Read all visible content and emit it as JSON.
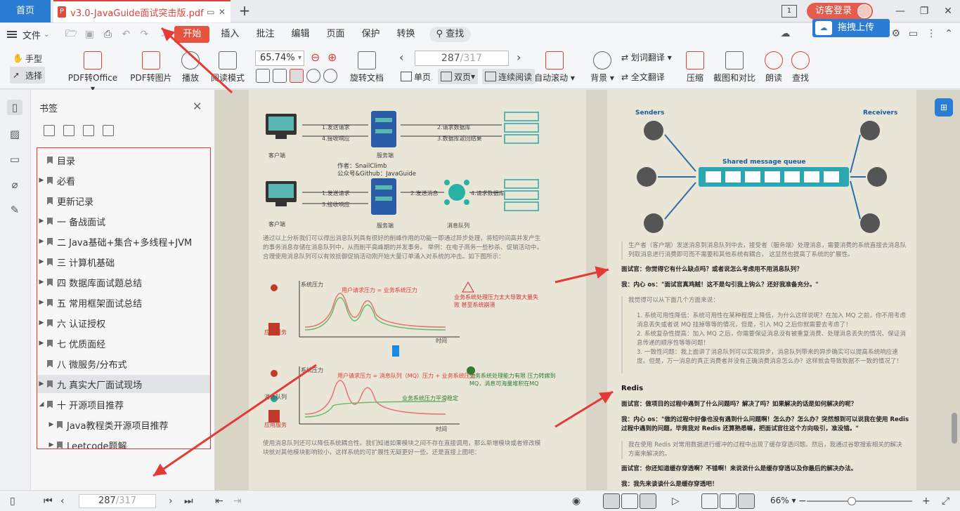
{
  "tabs": {
    "home": "首页",
    "doc_title": "v3.0-JavaGuide面试突击版.pdf",
    "pdf_icon": "P"
  },
  "window": {
    "guest_login": "访客登录",
    "panel_num": "1"
  },
  "menu": {
    "file": "文件",
    "items": [
      "开始",
      "插入",
      "批注",
      "编辑",
      "页面",
      "保护",
      "转换"
    ],
    "search": "查找",
    "upload": "拖拽上传"
  },
  "toolbar": {
    "hand": "手型",
    "select": "选择",
    "pdf_to_office": "PDF转Office",
    "pdf_to_image": "PDF转图片",
    "play": "播放",
    "read_mode": "阅读模式",
    "zoom": "65.74%",
    "rotate": "旋转文档",
    "page_current": "287",
    "page_total": "/317",
    "single": "单页",
    "double": "双页",
    "continuous": "连续阅读",
    "auto_scroll": "自动滚动",
    "background": "背景",
    "word_translate": "划词翻译",
    "full_translate": "全文翻译",
    "compress": "压缩",
    "screenshot_compare": "截图和对比",
    "read_aloud": "朗读",
    "find": "查找"
  },
  "bookmarks": {
    "title": "书签",
    "items": [
      {
        "label": "目录",
        "arrow": ""
      },
      {
        "label": "必看",
        "arrow": "▶"
      },
      {
        "label": "更新记录",
        "arrow": ""
      },
      {
        "label": "一 备战面试",
        "arrow": "▶"
      },
      {
        "label": "二 Java基础+集合+多线程+JVM",
        "arrow": "▶"
      },
      {
        "label": "三 计算机基础",
        "arrow": "▶"
      },
      {
        "label": "四 数据库面试题总结",
        "arrow": "▶"
      },
      {
        "label": "五 常用框架面试总结",
        "arrow": "▶"
      },
      {
        "label": "六 认证授权",
        "arrow": "▶"
      },
      {
        "label": "七 优质面经",
        "arrow": "▶"
      },
      {
        "label": "八 微服务/分布式",
        "arrow": ""
      },
      {
        "label": "九 真实大厂面试现场",
        "arrow": "▶"
      },
      {
        "label": "十 开源项目推荐",
        "arrow": "◢"
      },
      {
        "label": "Java教程类开源项目推荐",
        "arrow": "▶"
      },
      {
        "label": "Leetcode题解",
        "arrow": "▶"
      }
    ]
  },
  "left_page": {
    "d1_client": "客户端",
    "d1_server": "服务端",
    "d1_req": "1.发送请求",
    "d1_resp": "4.接收响应",
    "d1_db_req": "2.请求数据库",
    "d1_db_resp": "3.数据库返回结果",
    "author": "作者：SnailClimb",
    "account": "公众号&Github：JavaGuide",
    "d2_req": "1.发送请求",
    "d2_resp": "3.接收响应",
    "d2_msg": "2.发送消息",
    "d2_db": "4.请求数据库",
    "d2_client": "客户端",
    "d2_server": "服务端",
    "d2_queue": "消息队列",
    "para1": "通过以上分析我们可以得出消息队列具有很好的削峰作用的功能一即通过异步处理，将短时间高并发产生的事务消息存储在消息队列中，从而削平高峰期的并发事务。 举例：在电子商务一些秒杀、促销活动中，合理使用消息队列可以有效抵御促销活动刚开始大量订单涌入对系统的冲击。如下图所示：",
    "chart1_y": "系统压力",
    "chart1_legend": "用户请求压力 = 业务系统压力",
    "chart1_warn": "业务系统处理压力太大导致大量失败 甚至系统崩溃",
    "chart1_app": "应用服务",
    "chart1_x": "时间",
    "chart2_y": "系统压力",
    "chart2_legend": "用户请求压力 = 消息队列（MQ）压力 + 业务系统压力",
    "chart2_ok": "业务系统处理能力有限 压力转嫁到 MQ，消息可海量堆积在MQ",
    "chart2_stable": "业务系统压力平滑稳定",
    "chart2_mq": "消息队列",
    "chart2_app": "应用服务",
    "chart2_x": "时间",
    "para2": "使用消息队列还可以降低系统耦合性。我们知道如果模块之间不存在直接调用，那么新增模块或者修改模块就对其他模块影响较小，这样系统的可扩展性无疑更好一些。还是直接上图吧："
  },
  "right_page": {
    "senders": "Senders",
    "receivers": "Receivers",
    "queue": "Shared message queue",
    "para1": "生产者（客户端）发送消息到消息队列中去，接受者（服务端）处理消息，需要消费的系统直接去消息队列取消息进行消费即可而不需要和其他系统有耦合， 这显然也提高了系统的扩展性。",
    "q1": "面试官：你觉得它有什么缺点吗？或者说怎么考虑用不用消息队列？",
    "a1": "我：内心 os：\"面试官真鸡贼！这不是勾引我上钩么？还好我准备充分。\"",
    "p2": "我觉得可以从下面几个方面来说：",
    "li1": "1. 系统可用性降低：系统可用性在某种程度上降低，为什么这样说呢？在加入 MQ 之前，你不用考虑消息丢失或者说 MQ 挂掉等等的情况，但是，引入 MQ 之后你就需要去考虑了！",
    "li2": "2. 系统复杂性提高：加入 MQ 之后，你需要保证消息没有被重复消费、处理消息丢失的情况、保证消息传递的顺序性等等问题！",
    "li3": "3. 一致性问题：我上面讲了消息队列可以实现异步，消息队列带来的异步确实可以提高系统响应速度。但是，万一消息的真正消费者并没有正确消费消息怎么办？这样就会导致数据不一致的情况了！",
    "h_redis": "Redis",
    "q2": "面试官：做项目的过程中遇到了什么问题吗？解决了吗？如果解决的话是如何解决的呢？",
    "a2": "我：内心 os：\"做的过程中好像也没有遇到什么问题啊！怎么办？怎么办？突然想到可以说我在使用 Redis 过程中遇到的问题，毕竟我对 Redis 还算熟悉嘛，把面试官往这个方向吸引，准没错。\"",
    "p3": "我在使用 Redis 对常用数据进行缓冲的过程中出现了缓存穿透问题。然后，我通过谷歌搜索相关的解决方案来解决的。",
    "q3": "面试官：你还知道缓存穿透啊？不错啊！来说说什么是缓存穿透以及你最后的解决办法。",
    "a3": "我：我先来谈谈什么是缓存穿透吧！"
  },
  "status": {
    "page_current": "287",
    "page_total": "/317",
    "zoom": "66%"
  }
}
